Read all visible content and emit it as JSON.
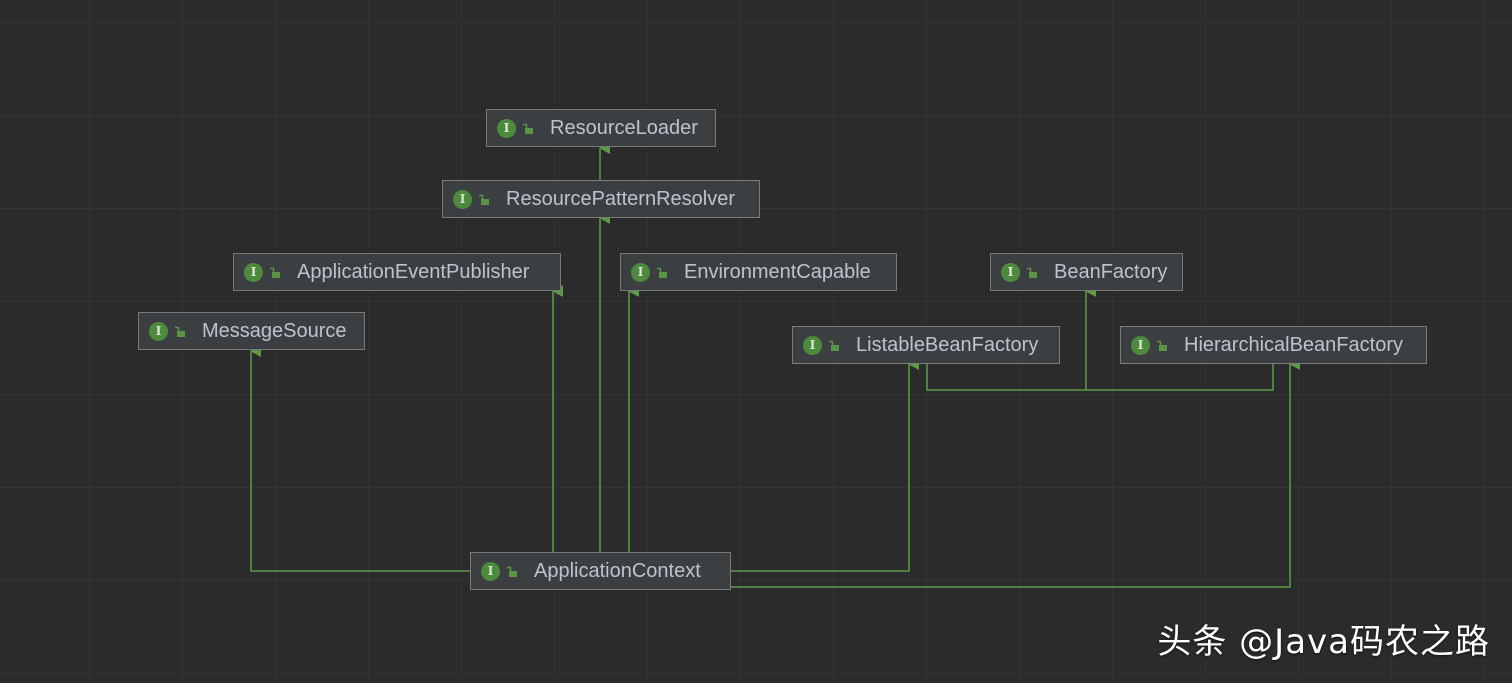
{
  "diagram": {
    "interface_badge": "I",
    "nodes": [
      {
        "id": "resource-loader",
        "label": "ResourceLoader"
      },
      {
        "id": "resource-pattern-resolver",
        "label": "ResourcePatternResolver"
      },
      {
        "id": "application-event-publisher",
        "label": "ApplicationEventPublisher"
      },
      {
        "id": "environment-capable",
        "label": "EnvironmentCapable"
      },
      {
        "id": "bean-factory",
        "label": "BeanFactory"
      },
      {
        "id": "message-source",
        "label": "MessageSource"
      },
      {
        "id": "listable-bean-factory",
        "label": "ListableBeanFactory"
      },
      {
        "id": "hierarchical-bean-factory",
        "label": "HierarchicalBeanFactory"
      },
      {
        "id": "application-context",
        "label": "ApplicationContext"
      }
    ],
    "edges": [
      {
        "from": "resource-pattern-resolver",
        "to": "resource-loader"
      },
      {
        "from": "application-context",
        "to": "resource-pattern-resolver"
      },
      {
        "from": "application-context",
        "to": "application-event-publisher"
      },
      {
        "from": "application-context",
        "to": "environment-capable"
      },
      {
        "from": "application-context",
        "to": "message-source"
      },
      {
        "from": "application-context",
        "to": "listable-bean-factory"
      },
      {
        "from": "application-context",
        "to": "hierarchical-bean-factory"
      },
      {
        "from": "listable-bean-factory",
        "to": "bean-factory"
      },
      {
        "from": "hierarchical-bean-factory",
        "to": "bean-factory"
      }
    ],
    "colors": {
      "background": "#2b2b2b",
      "grid": "#333333",
      "node_fill": "#3c3f41",
      "node_border": "#7a7a7a",
      "node_text": "#bbc4ce",
      "edge": "#5e9b47",
      "badge": "#4e8a3e"
    }
  },
  "watermark": "头条 @Java码农之路"
}
